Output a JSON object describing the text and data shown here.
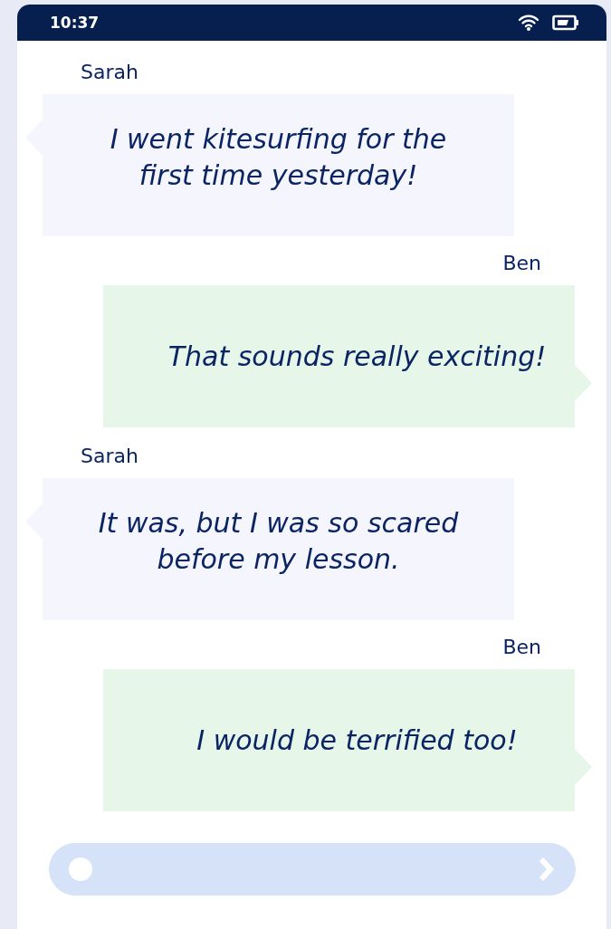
{
  "status_bar": {
    "time": "10:37"
  },
  "messages": [
    {
      "kind": "incoming",
      "sender": "Sarah",
      "text": "I went kitesurfing for the first time yesterday!"
    },
    {
      "kind": "outgoing",
      "sender": "Ben",
      "text": "That sounds really exciting!"
    },
    {
      "kind": "incoming",
      "sender": "Sarah",
      "text": "It was, but I was so scared before my lesson."
    },
    {
      "kind": "outgoing",
      "sender": "Ben",
      "text": "I would be terrified too!"
    }
  ]
}
